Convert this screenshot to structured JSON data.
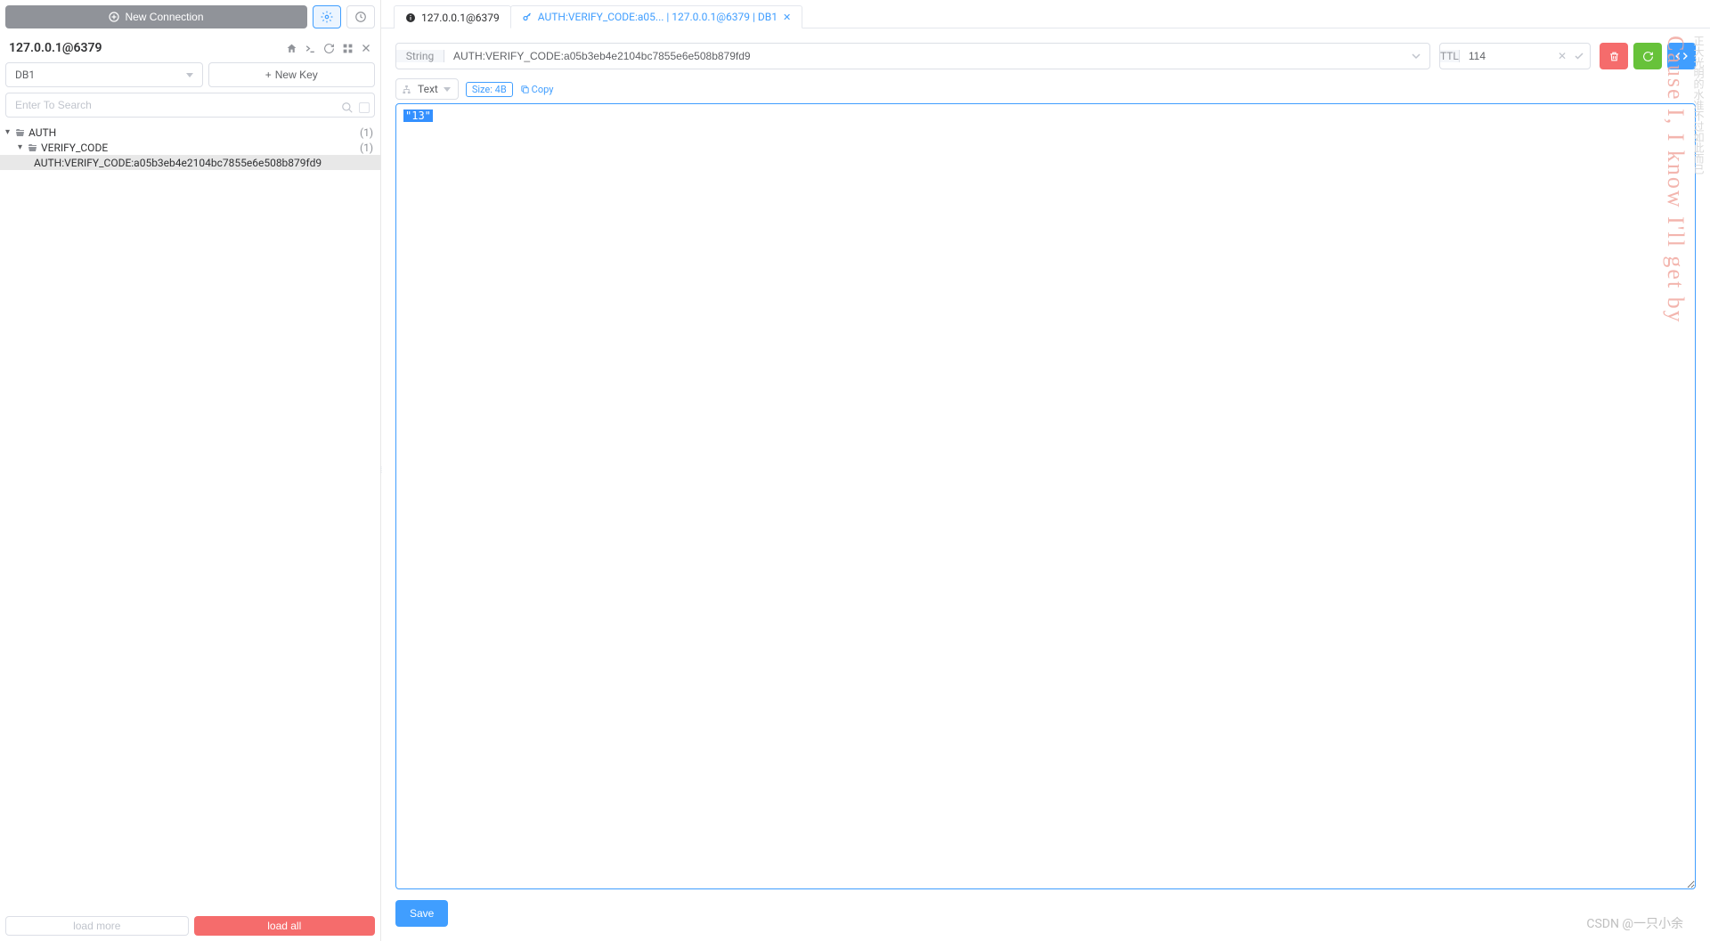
{
  "sidebar": {
    "new_connection_label": "New Connection",
    "connection_title": "127.0.0.1@6379",
    "db_selected": "DB1",
    "new_key_label": "New Key",
    "search_placeholder": "Enter To Search",
    "tree": {
      "node0_label": "AUTH",
      "node0_count": "(1)",
      "node1_label": "VERIFY_CODE",
      "node1_count": "(1)",
      "node2_label": "AUTH:VERIFY_CODE:a05b3eb4e2104bc7855e6e508b879fd9"
    },
    "load_more_label": "load more",
    "load_all_label": "load all"
  },
  "tabs": {
    "tab0_label": "127.0.0.1@6379",
    "tab1_label": "AUTH:VERIFY_CODE:a05... | 127.0.0.1@6379 | DB1"
  },
  "key_editor": {
    "type_label": "String",
    "key_value": "AUTH:VERIFY_CODE:a05b3eb4e2104bc7855e6e508b879fd9",
    "ttl_label": "TTL",
    "ttl_value": "114",
    "format_label": "Text",
    "size_label": "Size: 4B",
    "copy_label": "Copy",
    "value_content": "\"13\"",
    "save_label": "Save"
  },
  "watermarks": {
    "right_text": "Cause I, I know I'll get by",
    "bottom_text": "CSDN @一只小余"
  }
}
